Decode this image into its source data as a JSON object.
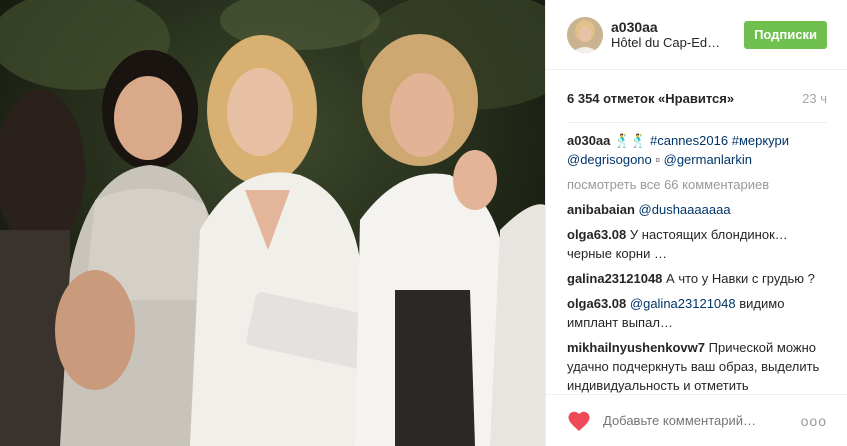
{
  "header": {
    "username": "a030aa",
    "location": "Hôtel du Cap-Ed…",
    "follow_label": "Подписки"
  },
  "stats": {
    "likes": "6 354 отметок «Нравится»",
    "time": "23 ч"
  },
  "caption": {
    "user": "a030aa",
    "emoji": "🕺🕺",
    "tag1": "#cannes2016",
    "tag2": "#меркури",
    "mention1": "@degrisogono",
    "mention2": "@germanlarkin"
  },
  "view_all": "посмотреть все 66 комментариев",
  "comments": [
    {
      "user": "anibabaian",
      "text": "",
      "mention": "@dushaaaaaaa"
    },
    {
      "user": "olga63.08",
      "text": "У настоящих блондинок… черные корни …",
      "mention": ""
    },
    {
      "user": "galina23121048",
      "text": "А что у Навки с грудью ?",
      "mention": ""
    },
    {
      "user": "olga63.08",
      "mention": "@galina23121048",
      "text": "видимо имплант выпал…"
    },
    {
      "user": "mikhailnyushenkovw7",
      "text": "Прической можно удачно подчеркнуть ваш образ, выделить индивидуальность и отметить безупречный вкус.🙂",
      "mention": ""
    }
  ],
  "footer": {
    "add_placeholder": "Добавьте комментарий…",
    "more": "ооо"
  },
  "colors": {
    "follow": "#70c050",
    "link": "#003569",
    "heart": "#ed4956"
  }
}
